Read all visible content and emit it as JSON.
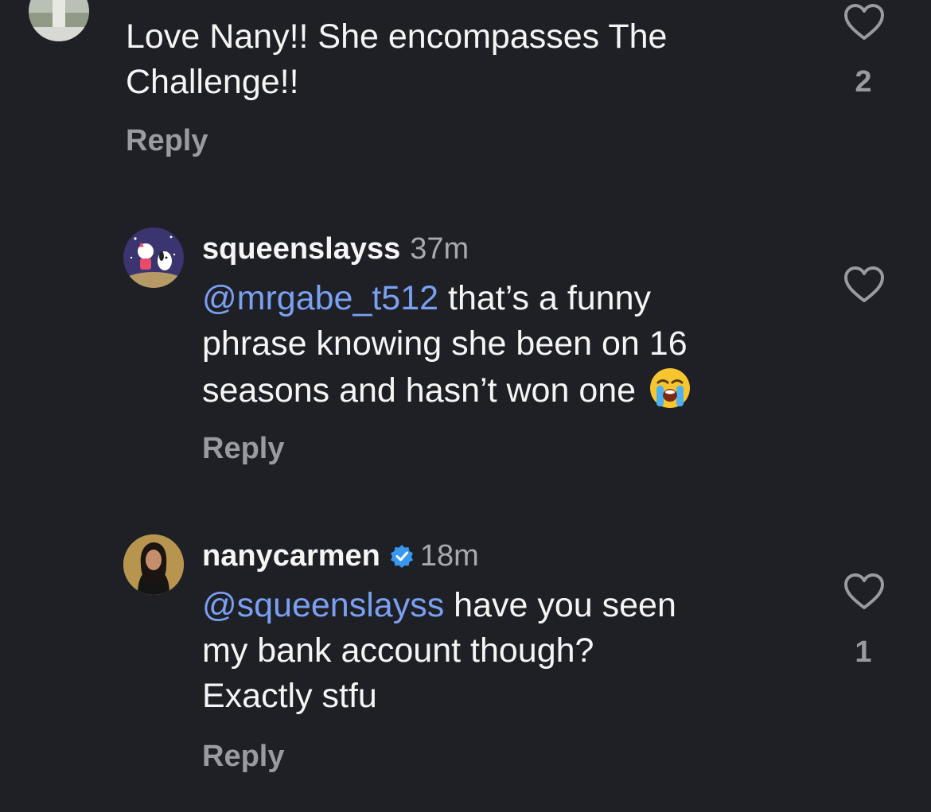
{
  "comments": [
    {
      "text": "Love Nany!! She encompasses The",
      "text_line2": "Challenge!!",
      "reply_label": "Reply",
      "like_count": "2",
      "like_icon": "heart-outline-icon"
    },
    {
      "username": "squeenslayss",
      "time": "37m",
      "mention": "@mrgabe_t512",
      "text_line1": " that’s a funny",
      "text_line2": "phrase knowing she been on 16",
      "text_line3": "seasons and hasn’t won one",
      "emoji": "loudly-crying-face-emoji",
      "reply_label": "Reply",
      "like_icon": "heart-outline-icon"
    },
    {
      "username": "nanycarmen",
      "verified_icon": "verified-badge-icon",
      "time": "18m",
      "mention": "@squeenslayss",
      "text_line1": " have you seen",
      "text_line2": "my bank account though?",
      "text_line3": "Exactly stfu",
      "reply_label": "Reply",
      "like_count": "1",
      "like_icon": "heart-outline-icon"
    }
  ],
  "colors": {
    "background": "#1f2025",
    "text": "#f5f5f5",
    "muted": "#9a9ba1",
    "mention": "#7aa0f2",
    "verified": "#3897f0"
  }
}
